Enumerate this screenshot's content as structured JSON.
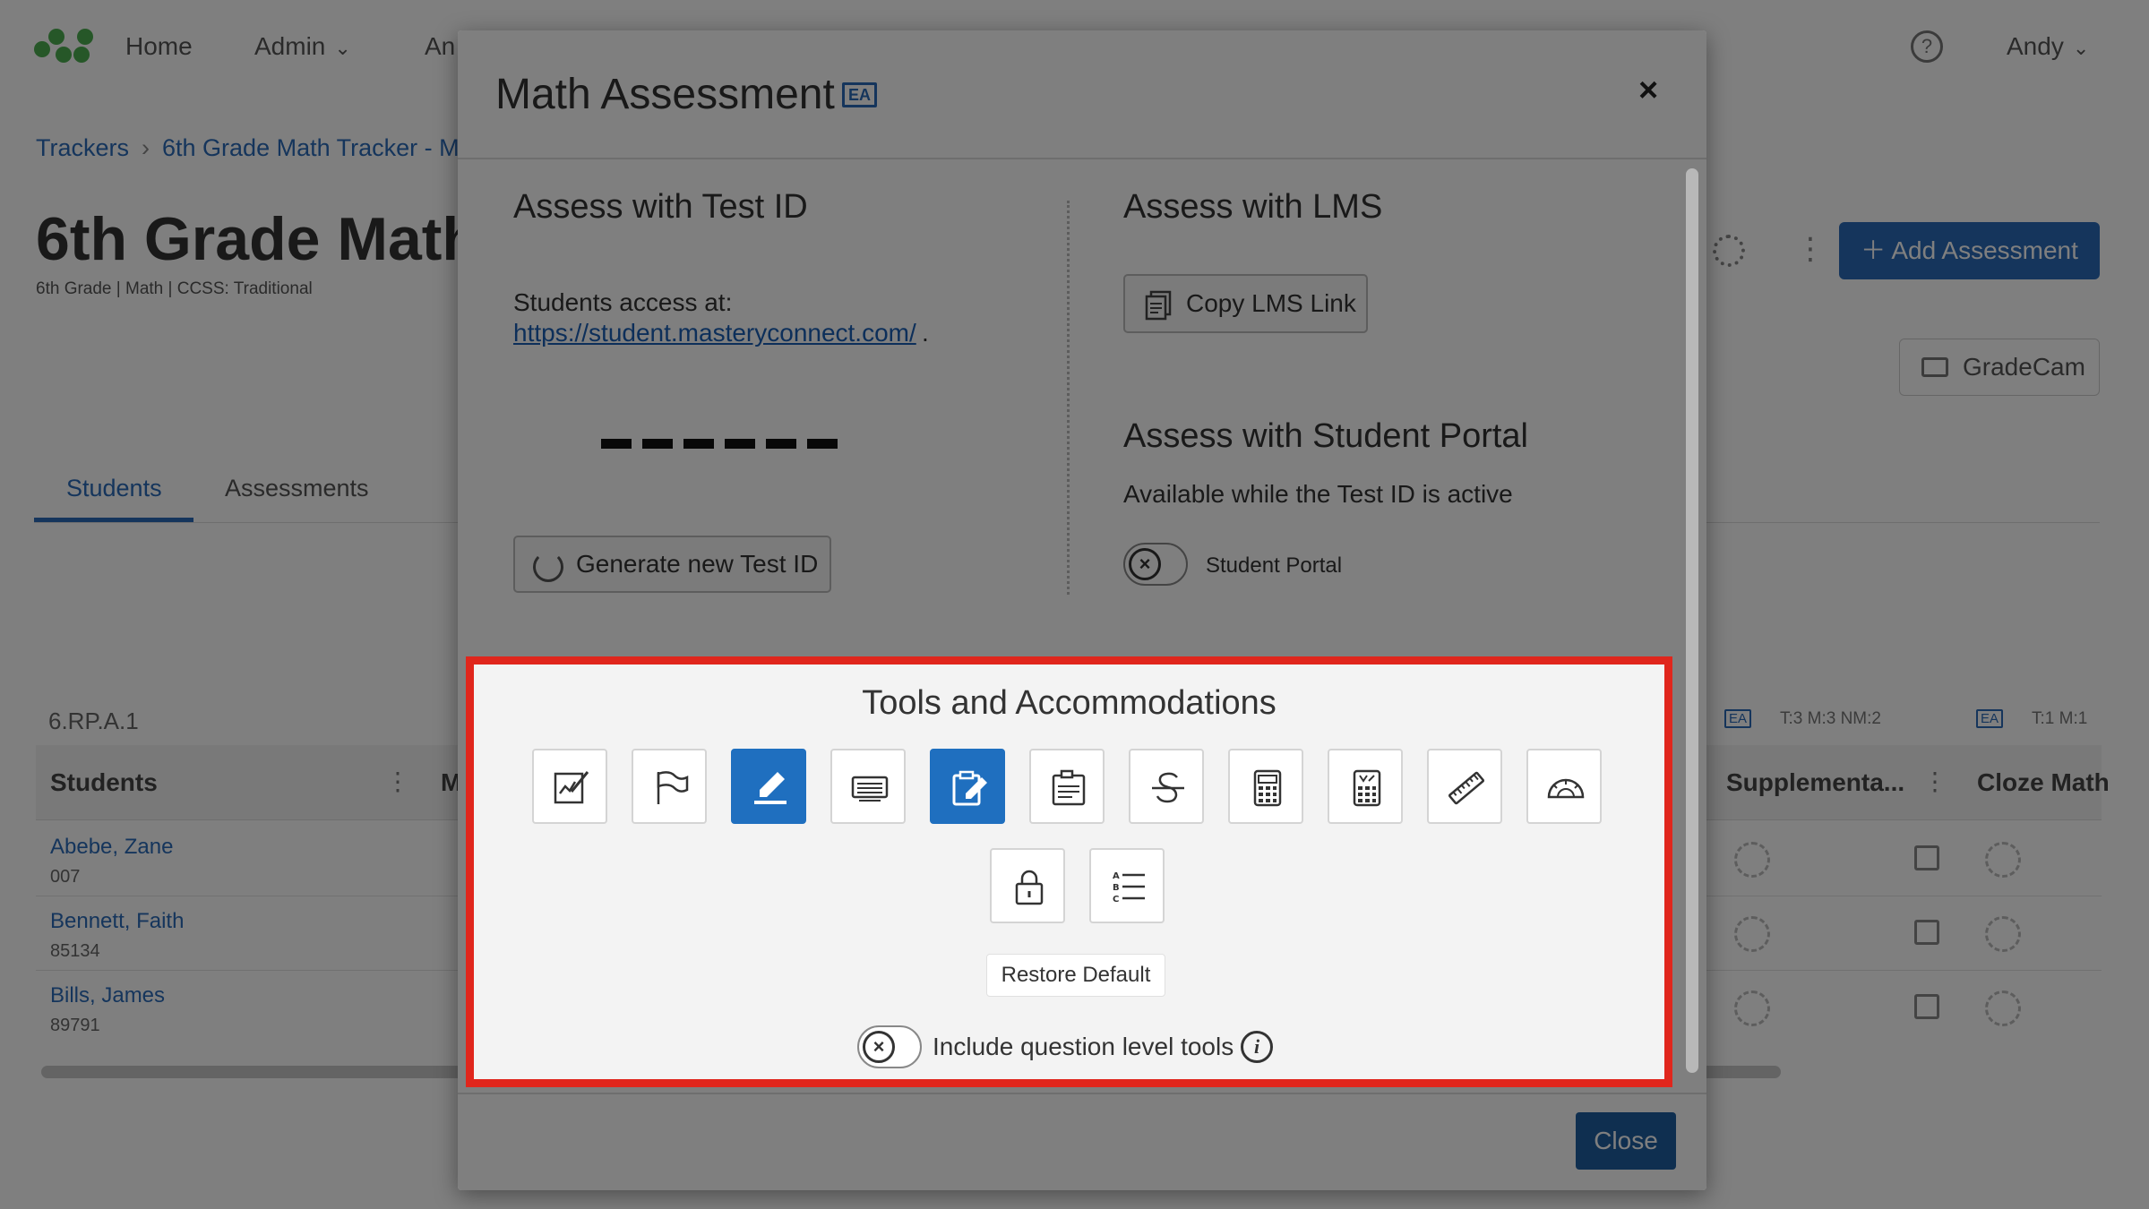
{
  "nav": {
    "home": "Home",
    "admin": "Admin",
    "analytics_partial": "An",
    "user": "Andy"
  },
  "breadcrumb": {
    "root": "Trackers",
    "current": "6th Grade Math Tracker - M"
  },
  "page": {
    "title": "6th Grade Math",
    "subtitle": "6th Grade  |  Math  |  CCSS: Traditional"
  },
  "actions": {
    "add_assessment": "Add Assessment",
    "gradecam": "GradeCam"
  },
  "tabs": [
    "Students",
    "Assessments"
  ],
  "grid": {
    "standard": "6.RP.A.1",
    "students_header": "Students",
    "partial_header": "M",
    "supplemental_header": "Supplementa...",
    "cloze_header": "Cloze Math",
    "ea_tag": "EA",
    "supplemental_meta": "T:3 M:3 NM:2",
    "cloze_meta": "T:1 M:1",
    "students": [
      {
        "name": "Abebe, Zane",
        "id": "007"
      },
      {
        "name": "Bennett, Faith",
        "id": "85134"
      },
      {
        "name": "Bills, James",
        "id": "89791"
      }
    ]
  },
  "modal": {
    "title": "Math Assessment",
    "badge": "EA",
    "close_x": "×",
    "test_id": {
      "heading": "Assess with Test ID",
      "access_label": "Students access at:",
      "access_url": "https://student.masteryconnect.com/",
      "access_suffix": ".",
      "generate_label": "Generate new Test ID"
    },
    "lms": {
      "heading": "Assess with LMS",
      "copy_label": "Copy LMS Link"
    },
    "portal": {
      "heading": "Assess with Student Portal",
      "subtext": "Available while the Test ID is active",
      "toggle_label": "Student Portal",
      "toggle_on": false
    },
    "tools": {
      "heading": "Tools and Accommodations",
      "items": [
        {
          "icon": "notepad-edit-icon",
          "active": false
        },
        {
          "icon": "flag-icon",
          "active": false
        },
        {
          "icon": "highlighter-icon",
          "active": true
        },
        {
          "icon": "line-reader-icon",
          "active": false
        },
        {
          "icon": "notes-icon",
          "active": true
        },
        {
          "icon": "clipboard-icon",
          "active": false
        },
        {
          "icon": "strikethrough-icon",
          "active": false
        },
        {
          "icon": "basic-calculator-icon",
          "active": false
        },
        {
          "icon": "scientific-calculator-icon",
          "active": false
        },
        {
          "icon": "ruler-icon",
          "active": false
        },
        {
          "icon": "protractor-icon",
          "active": false
        },
        {
          "icon": "lock-icon",
          "active": false
        },
        {
          "icon": "abc-list-icon",
          "active": false
        }
      ],
      "restore_label": "Restore Default",
      "question_level_label": "Include question level tools",
      "question_level_on": false
    },
    "close_label": "Close"
  },
  "colors": {
    "brand_blue": "#2a6bb8",
    "active_tool": "#1f6fbf",
    "highlight_border": "#e0261c",
    "logo_green": "#4caf50"
  }
}
